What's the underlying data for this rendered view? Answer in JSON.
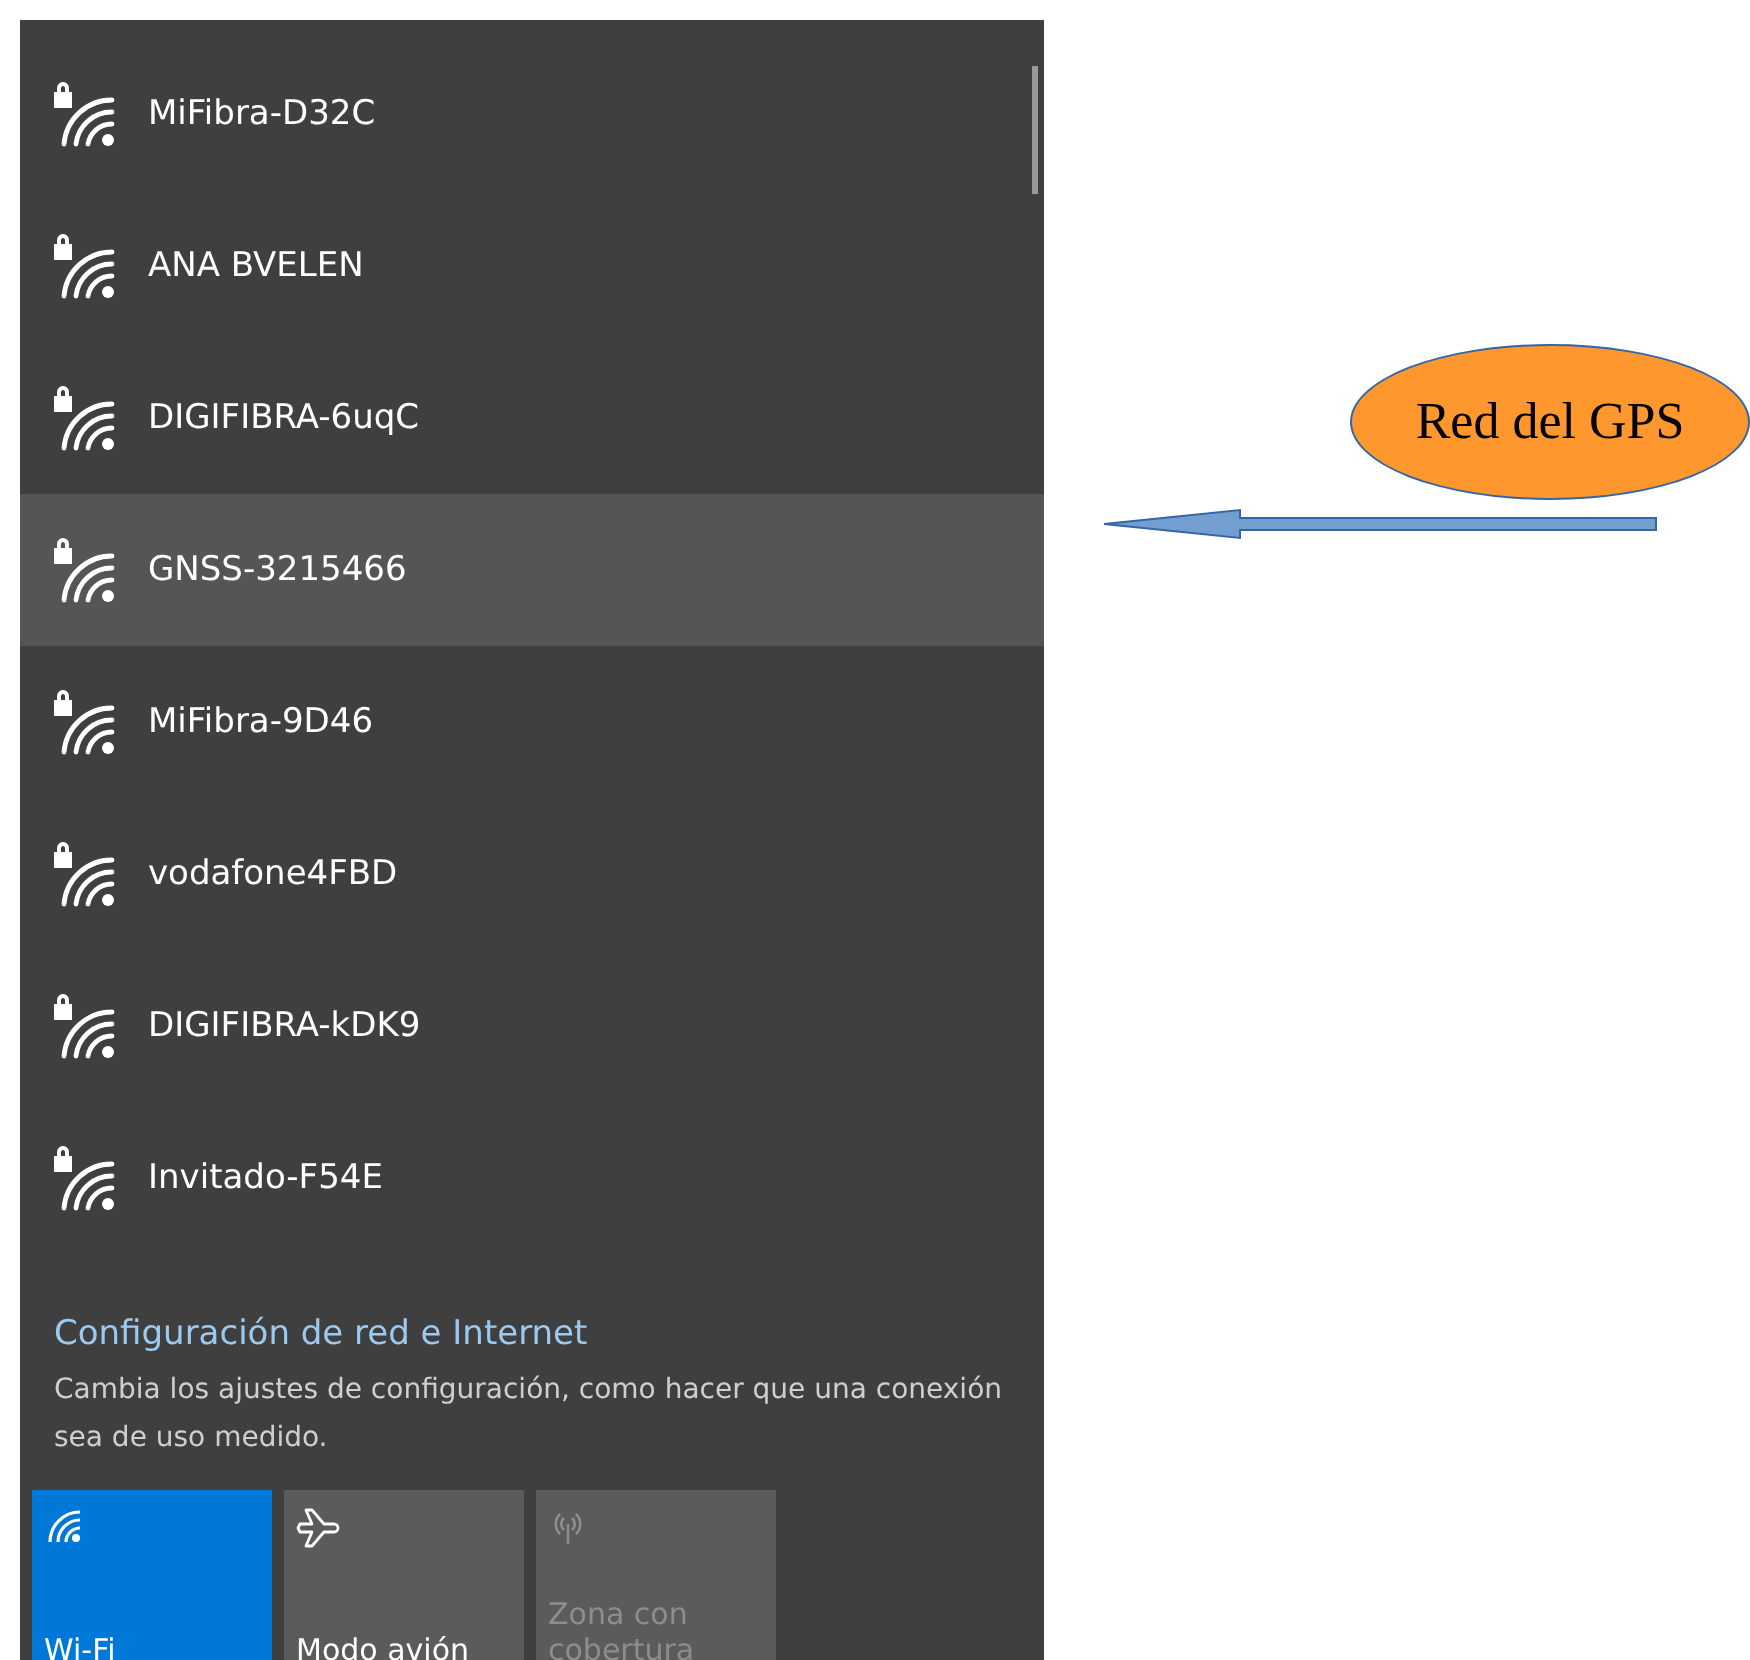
{
  "networks": [
    {
      "name": "MiFibra-D32C",
      "selected": false
    },
    {
      "name": "ANA BVELEN",
      "selected": false
    },
    {
      "name": "DIGIFIBRA-6uqC",
      "selected": false
    },
    {
      "name": "GNSS-3215466",
      "selected": true
    },
    {
      "name": "MiFibra-9D46",
      "selected": false
    },
    {
      "name": "vodafone4FBD",
      "selected": false
    },
    {
      "name": "DIGIFIBRA-kDK9",
      "selected": false
    },
    {
      "name": "Invitado-F54E",
      "selected": false
    }
  ],
  "settings": {
    "link": "Configuración de red e Internet",
    "description": "Cambia los ajustes de configuración, como hacer que una conexión sea de uso medido."
  },
  "tiles": [
    {
      "kind": "wifi",
      "label": "Wi-Fi",
      "on": true,
      "disabled": false
    },
    {
      "kind": "airplane",
      "label": "Modo avión",
      "on": false,
      "disabled": false
    },
    {
      "kind": "hotspot",
      "label": "Zona con cobertura",
      "on": false,
      "disabled": true
    }
  ],
  "annotation": {
    "label": "Red del GPS"
  }
}
